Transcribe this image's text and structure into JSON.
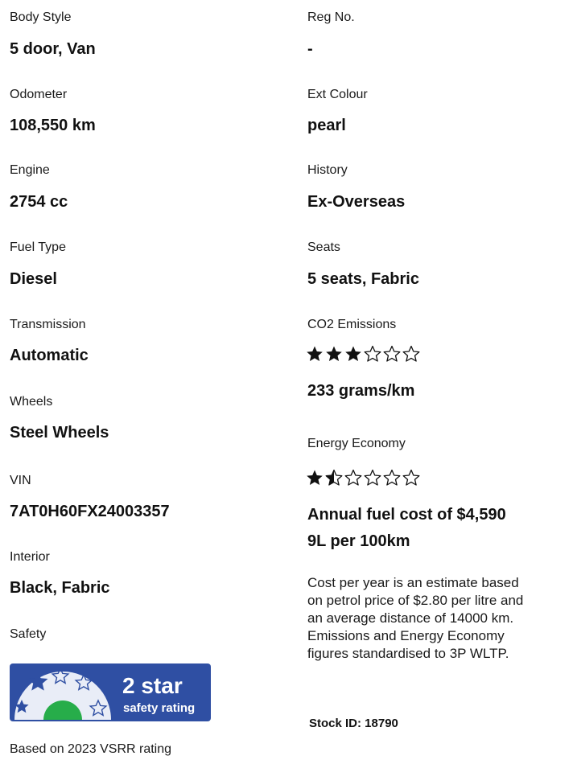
{
  "specs": {
    "body_style": {
      "label": "Body Style",
      "value": "5 door, Van"
    },
    "reg_no": {
      "label": "Reg No.",
      "value": "-"
    },
    "odometer": {
      "label": "Odometer",
      "value": "108,550 km"
    },
    "ext_colour": {
      "label": "Ext Colour",
      "value": "pearl"
    },
    "engine": {
      "label": "Engine",
      "value": "2754 cc"
    },
    "history": {
      "label": "History",
      "value": "Ex-Overseas"
    },
    "fuel_type": {
      "label": "Fuel Type",
      "value": "Diesel"
    },
    "seats": {
      "label": "Seats",
      "value": "5 seats, Fabric"
    },
    "transmission": {
      "label": "Transmission",
      "value": "Automatic"
    },
    "wheels": {
      "label": "Wheels",
      "value": "Steel Wheels"
    },
    "vin": {
      "label": "VIN",
      "value": "7AT0H60FX24003357"
    },
    "interior": {
      "label": "Interior",
      "value": "Black, Fabric"
    }
  },
  "co2": {
    "label": "CO2 Emissions",
    "rating": 3,
    "max_rating": 6,
    "value": "233 grams/km"
  },
  "energy": {
    "label": "Energy Economy",
    "rating": 1.5,
    "max_rating": 6,
    "fuel_cost": "Annual fuel cost of $4,590",
    "consumption": "9L per 100km"
  },
  "safety": {
    "label": "Safety",
    "badge_rating": "2 star",
    "badge_text": "safety rating",
    "rating": 2,
    "footnote": "Based on 2023 VSRR rating",
    "colors": {
      "badge_blue": "#2f4fa3",
      "badge_green": "#27ad4a",
      "badge_light": "#e9edf7"
    }
  },
  "note": {
    "line1": "Cost per year is an estimate based",
    "line2": "on petrol price of  $2.80 per litre and",
    "line3": "an average distance of 14000 km.",
    "line4": "Emissions and Energy Economy",
    "line5": "figures standardised to 3P WLTP."
  },
  "stock": {
    "text": "Stock ID: 18790"
  }
}
